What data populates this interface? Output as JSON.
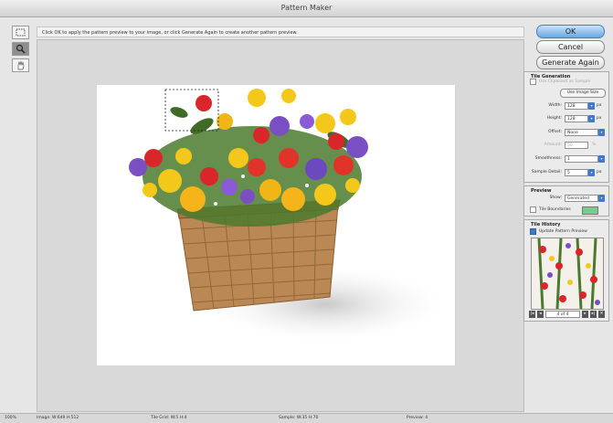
{
  "window": {
    "title": "Pattern Maker"
  },
  "tools": [
    {
      "name": "marquee-tool"
    },
    {
      "name": "zoom-tool"
    },
    {
      "name": "hand-tool"
    }
  ],
  "hint": "Click OK to apply the pattern preview to your image, or click Generate Again to create another pattern preview.",
  "buttons": {
    "ok": "OK",
    "cancel": "Cancel",
    "generate": "Generate Again"
  },
  "tile_generation": {
    "title": "Tile Generation",
    "use_clipboard": "Use Clipboard as Sample",
    "use_image_size": "Use Image Size",
    "width_label": "Width:",
    "width": "128",
    "width_unit": "px",
    "height_label": "Height:",
    "height": "128",
    "height_unit": "px",
    "offset_label": "Offset:",
    "offset": "None",
    "amount_label": "Amount:",
    "amount": "50",
    "amount_unit": "%",
    "smoothness_label": "Smoothness:",
    "smoothness": "1",
    "sample_label": "Sample Detail:",
    "sample": "5",
    "sample_unit": "px"
  },
  "preview": {
    "title": "Preview",
    "show_label": "Show:",
    "show": "Generated",
    "tile_boundaries": "Tile Boundaries",
    "boundary_color": "#6fcf8d"
  },
  "tile_history": {
    "title": "Tile History",
    "update_label": "Update Pattern Preview",
    "counter": "4 of 4"
  },
  "status": {
    "zoom": "100%",
    "image": "Image: W:649 H:512",
    "tile_grid": "Tile Grid: W:5 H:4",
    "sample": "Sample: W:35 H:70",
    "preview": "Preview: 4"
  },
  "colors": {
    "accent": "#3f79c8",
    "ok_button": "#6aa7e3"
  }
}
